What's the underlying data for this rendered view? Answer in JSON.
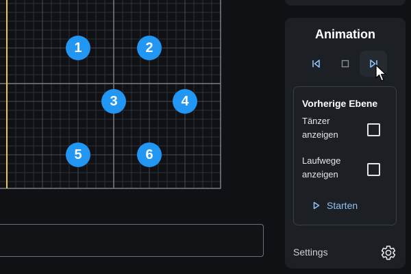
{
  "colors": {
    "background": "#0f1115",
    "panel": "#1c1f24",
    "dancer": "#2196f3",
    "accent": "#90c2f8",
    "timeline_marker": "#f2c94c"
  },
  "stage": {
    "dancers": [
      {
        "label": "1"
      },
      {
        "label": "2"
      },
      {
        "label": "3"
      },
      {
        "label": "4"
      },
      {
        "label": "5"
      },
      {
        "label": "6"
      }
    ]
  },
  "animation": {
    "title": "Animation",
    "controls": [
      {
        "icon": "skip-to-start-icon",
        "state": "idle"
      },
      {
        "icon": "stop-icon",
        "state": "idle"
      },
      {
        "icon": "skip-to-end-icon",
        "state": "hovered"
      }
    ],
    "previous_layer": {
      "title": "Vorherige Ebene",
      "options": [
        {
          "label": "Tänzer anzeigen",
          "checked": false
        },
        {
          "label": "Laufwege anzeigen",
          "checked": false
        }
      ],
      "start_label": "Starten"
    }
  },
  "settings": {
    "label": "Settings",
    "icon": "gear-icon"
  }
}
